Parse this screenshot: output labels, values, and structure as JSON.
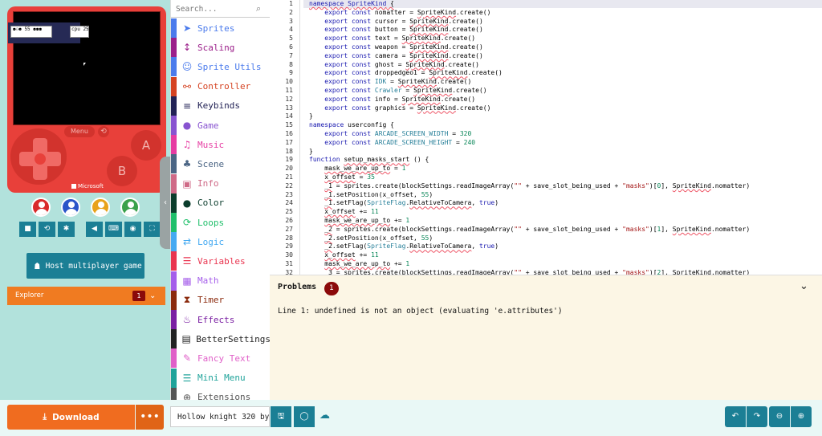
{
  "simulator": {
    "hud_text_1": "⚉⚇⚈ 55   ⚉⚉⚉ ",
    "hud_text_2": "cpu 255",
    "menu_label": "Menu",
    "restart_glyph": "⟲",
    "button_a": "A",
    "button_b": "B",
    "brand": "Microsoft",
    "players": [
      {
        "color": "#d92a2a"
      },
      {
        "color": "#2a55c9"
      },
      {
        "color": "#e8a21a"
      },
      {
        "color": "#3aa14a"
      }
    ],
    "toolbar_icons": [
      "stop-icon",
      "restart-icon",
      "debug-icon",
      "mute-icon",
      "keyboard-icon",
      "screenshot-icon",
      "fullscreen-icon"
    ],
    "toolbar_glyphs": [
      "■",
      "⟲",
      "✱",
      "◀",
      "⌨",
      "◉",
      "⛶"
    ],
    "host_button": "Host multiplayer game",
    "host_icon": "☗",
    "explorer_label": "Explorer",
    "explorer_count": "1",
    "explorer_chev": "⌄",
    "collapse_glyph": "‹"
  },
  "toolbox": {
    "search_placeholder": "Search...",
    "search_glyph": "⌕",
    "categories": [
      {
        "label": "Sprites",
        "color": "#4b7bec",
        "glyph": "➤",
        "icon": "sprites-icon"
      },
      {
        "label": "Scaling",
        "color": "#9b1f8a",
        "glyph": "↕",
        "icon": "scaling-icon"
      },
      {
        "label": "Sprite Utils",
        "color": "#4b7bec",
        "glyph": "☺",
        "icon": "sprite-utils-icon"
      },
      {
        "label": "Controller",
        "color": "#d54322",
        "glyph": "⚯",
        "icon": "controller-icon"
      },
      {
        "label": "Keybinds",
        "color": "#222255",
        "glyph": "≡",
        "icon": "keybinds-icon"
      },
      {
        "label": "Game",
        "color": "#8854d0",
        "glyph": "●",
        "icon": "game-icon"
      },
      {
        "label": "Music",
        "color": "#e63ca2",
        "glyph": "♫",
        "icon": "music-icon"
      },
      {
        "label": "Scene",
        "color": "#4b6584",
        "glyph": "♣",
        "icon": "scene-icon"
      },
      {
        "label": "Info",
        "color": "#cf6a87",
        "glyph": "▣",
        "icon": "info-icon"
      },
      {
        "label": "Color",
        "color": "#0b3d2c",
        "glyph": "●",
        "icon": "color-icon"
      },
      {
        "label": "Loops",
        "color": "#20bf6b",
        "glyph": "⟳",
        "icon": "loops-icon"
      },
      {
        "label": "Logic",
        "color": "#45aaf2",
        "glyph": "⇄",
        "icon": "logic-icon"
      },
      {
        "label": "Variables",
        "color": "#e9344f",
        "glyph": "☰",
        "icon": "variables-icon"
      },
      {
        "label": "Math",
        "color": "#a55eea",
        "glyph": "▦",
        "icon": "math-icon"
      },
      {
        "label": "Timer",
        "color": "#8b2a0d",
        "glyph": "⧗",
        "icon": "timer-icon"
      },
      {
        "label": "Effects",
        "color": "#7a1fa2",
        "glyph": "♨",
        "icon": "effects-icon"
      },
      {
        "label": "BetterSettings",
        "color": "#222",
        "glyph": "▤",
        "icon": "bettersettings-icon"
      },
      {
        "label": "Fancy Text",
        "color": "#e060c8",
        "glyph": "✎",
        "icon": "fancy-text-icon"
      },
      {
        "label": "Mini Menu",
        "color": "#1fa39a",
        "glyph": "☰",
        "icon": "mini-menu-icon"
      },
      {
        "label": "Extensions",
        "color": "#555",
        "glyph": "⊕",
        "icon": "extensions-icon"
      }
    ]
  },
  "editor": {
    "line_numbers": [
      "1",
      "2",
      "3",
      "4",
      "5",
      "6",
      "7",
      "8",
      "9",
      "10",
      "11",
      "12",
      "13",
      "14",
      "15",
      "16",
      "17",
      "18",
      "19",
      "20",
      "21",
      "22",
      "23",
      "24",
      "25",
      "26",
      "27",
      "28",
      "29",
      "30",
      "31",
      "32"
    ],
    "problems_title": "Problems",
    "problems_count": "1",
    "problems_collapse_glyph": "⌄",
    "problem_message": "Line 1: undefined is not an object (evaluating 'e.attributes')"
  },
  "bottom": {
    "download_label": "Download",
    "download_glyph": "⤓",
    "more_glyph": "•••",
    "project_name": "Hollow knight 320 by",
    "save_glyph": "🖫",
    "github_glyph": "◯",
    "cloud_glyph": "☁",
    "undo_glyph": "↶",
    "redo_glyph": "↷",
    "zoom_out_glyph": "⊖",
    "zoom_in_glyph": "⊕"
  }
}
